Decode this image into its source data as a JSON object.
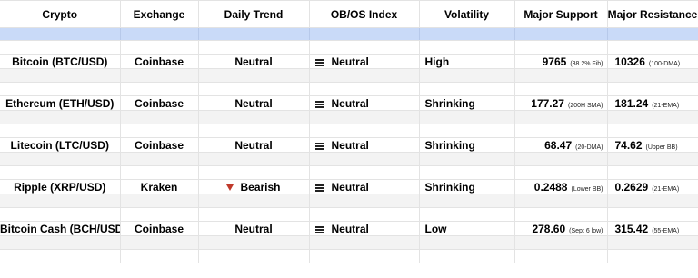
{
  "headers": {
    "crypto": "Crypto",
    "exchange": "Exchange",
    "daily_trend": "Daily Trend",
    "obos": "OB/OS Index",
    "volatility": "Volatility",
    "support": "Major Support",
    "resistance": "Major Resistance"
  },
  "rows": [
    {
      "crypto": "Bitcoin (BTC/USD)",
      "exchange": "Coinbase",
      "trend": "Neutral",
      "trend_icon": "none",
      "obos": "Neutral",
      "obos_icon": "neutral-bars-icon",
      "volatility": "High",
      "support": "9765",
      "support_note": "(38.2% Fib)",
      "resistance": "10326",
      "resistance_note": "(100-DMA)"
    },
    {
      "crypto": "Ethereum (ETH/USD)",
      "exchange": "Coinbase",
      "trend": "Neutral",
      "trend_icon": "none",
      "obos": "Neutral",
      "obos_icon": "neutral-bars-icon",
      "volatility": "Shrinking",
      "support": "177.27",
      "support_note": "(200H SMA)",
      "resistance": "181.24",
      "resistance_note": "(21-EMA)"
    },
    {
      "crypto": "Litecoin (LTC/USD)",
      "exchange": "Coinbase",
      "trend": "Neutral",
      "trend_icon": "none",
      "obos": "Neutral",
      "obos_icon": "neutral-bars-icon",
      "volatility": "Shrinking",
      "support": "68.47",
      "support_note": "(20-DMA)",
      "resistance": "74.62",
      "resistance_note": "(Upper BB)"
    },
    {
      "crypto": "Ripple (XRP/USD)",
      "exchange": "Kraken",
      "trend": "Bearish",
      "trend_icon": "down-triangle-icon",
      "obos": "Neutral",
      "obos_icon": "neutral-bars-icon",
      "volatility": "Shrinking",
      "support": "0.2488",
      "support_note": "(Lower BB)",
      "resistance": "0.2629",
      "resistance_note": "(21-EMA)"
    },
    {
      "crypto": "Bitcoin Cash (BCH/USD)",
      "exchange": "Coinbase",
      "trend": "Neutral",
      "trend_icon": "none",
      "obos": "Neutral",
      "obos_icon": "neutral-bars-icon",
      "volatility": "Low",
      "support": "278.60",
      "support_note": "(Sept 6 low)",
      "resistance": "315.42",
      "resistance_note": "(55-EMA)"
    }
  ],
  "colors": {
    "header_band": "#c9daf8",
    "bearish_triangle": "#c0392b",
    "spacer_grey": "#f3f3f3"
  }
}
